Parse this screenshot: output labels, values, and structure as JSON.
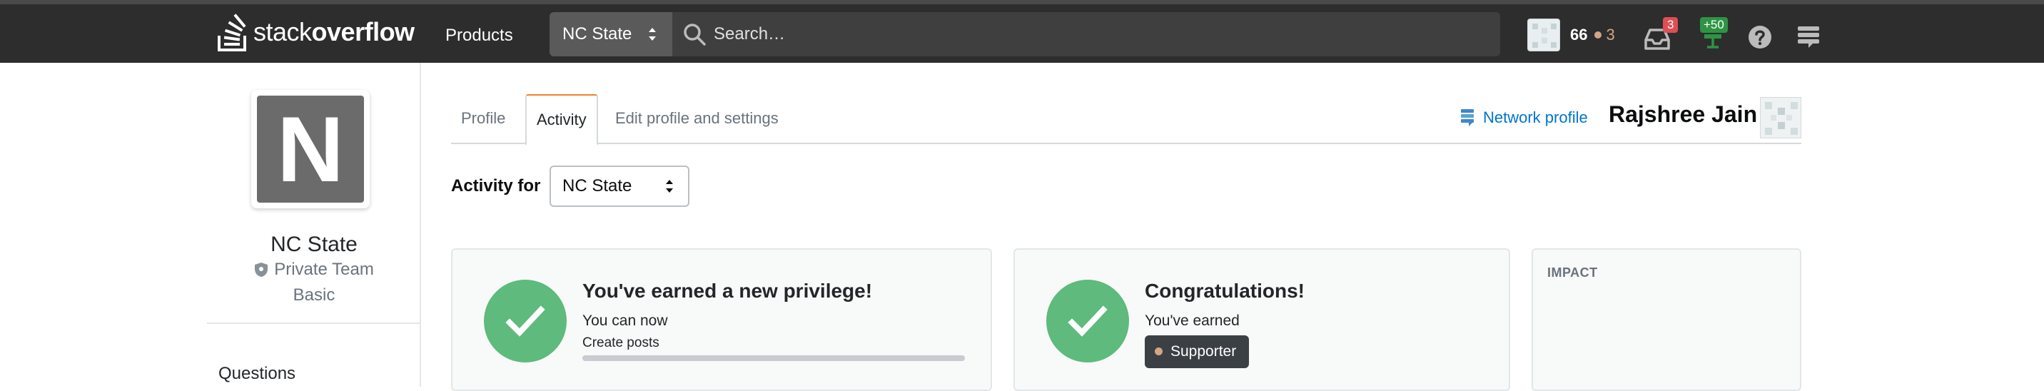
{
  "header": {
    "logo_text_light": "stack",
    "logo_text_bold": "overflow",
    "products_label": "Products",
    "team_selector_value": "NC State",
    "search_placeholder": "Search…",
    "reputation": "66",
    "bronze_badges": "3",
    "inbox_count": "3",
    "achievements_delta": "+50",
    "icons": {
      "logo": "stackoverflow-logo-icon",
      "search": "search-icon",
      "inbox": "inbox-icon",
      "achievements": "achievements-icon",
      "help": "help-icon",
      "sites": "site-switcher-icon"
    },
    "colors": {
      "bar": "#2d2d2d",
      "brand_orange": "#f48225"
    }
  },
  "sidebar": {
    "avatar_letter": "N",
    "team_name": "NC State",
    "team_type": "Private Team",
    "team_plan": "Basic",
    "nav_questions": "Questions"
  },
  "tabs": [
    {
      "label": "Profile"
    },
    {
      "label": "Activity"
    },
    {
      "label": "Edit profile and settings"
    }
  ],
  "profile": {
    "network_profile_label": "Network profile",
    "display_name": "Rajshree Jain"
  },
  "activity_filter": {
    "label": "Activity for",
    "selected": "NC State"
  },
  "cards": {
    "privilege": {
      "title": "You've earned a new privilege!",
      "subtitle": "You can now",
      "privilege_name": "Create posts",
      "progress_fraction": 1.0
    },
    "badge": {
      "title": "Congratulations!",
      "subtitle": "You've earned",
      "badge_name": "Supporter",
      "badge_class_color": "#d1a684"
    },
    "impact": {
      "label": "IMPACT"
    }
  },
  "colors": {
    "success_green": "#5eba7d",
    "link_blue": "#0074cc",
    "bronze": "#d1a684",
    "inbox_red": "#de4f54",
    "achievement_green": "#2e9444"
  }
}
